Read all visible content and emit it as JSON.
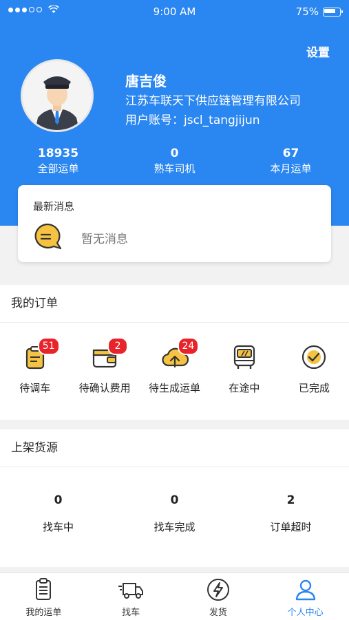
{
  "status_bar": {
    "time": "9:00 AM",
    "battery": "75%"
  },
  "header": {
    "settings_label": "设置",
    "name": "唐吉俊",
    "company": "江苏车联天下供应链管理有限公司",
    "account_label": "用户账号：",
    "account": "jscl_tangjijun"
  },
  "stats": [
    {
      "value": "18935",
      "label": "全部运单"
    },
    {
      "value": "0",
      "label": "熟车司机"
    },
    {
      "value": "67",
      "label": "本月运单"
    }
  ],
  "messages": {
    "title": "最新消息",
    "empty_text": "暂无消息"
  },
  "orders": {
    "title": "我的订单",
    "items": [
      {
        "label": "待调车",
        "badge": "51",
        "icon": "clipboard-icon"
      },
      {
        "label": "待确认费用",
        "badge": "2",
        "icon": "wallet-icon"
      },
      {
        "label": "待生成运单",
        "badge": "24",
        "icon": "cloud-upload-icon"
      },
      {
        "label": "在途中",
        "badge": "",
        "icon": "bus-icon"
      },
      {
        "label": "已完成",
        "badge": "",
        "icon": "check-circle-icon"
      }
    ]
  },
  "goods": {
    "title": "上架货源",
    "items": [
      {
        "value": "0",
        "label": "找车中"
      },
      {
        "value": "0",
        "label": "找车完成"
      },
      {
        "value": "2",
        "label": "订单超时"
      }
    ]
  },
  "tabbar": {
    "items": [
      {
        "label": "我的运单",
        "icon": "waybill-icon"
      },
      {
        "label": "找车",
        "icon": "truck-icon"
      },
      {
        "label": "发货",
        "icon": "lightning-icon"
      },
      {
        "label": "个人中心",
        "icon": "user-icon"
      }
    ],
    "active_index": 3
  },
  "colors": {
    "primary": "#2a86f0",
    "badge": "#e8242a",
    "icon_accent": "#f5c242"
  }
}
